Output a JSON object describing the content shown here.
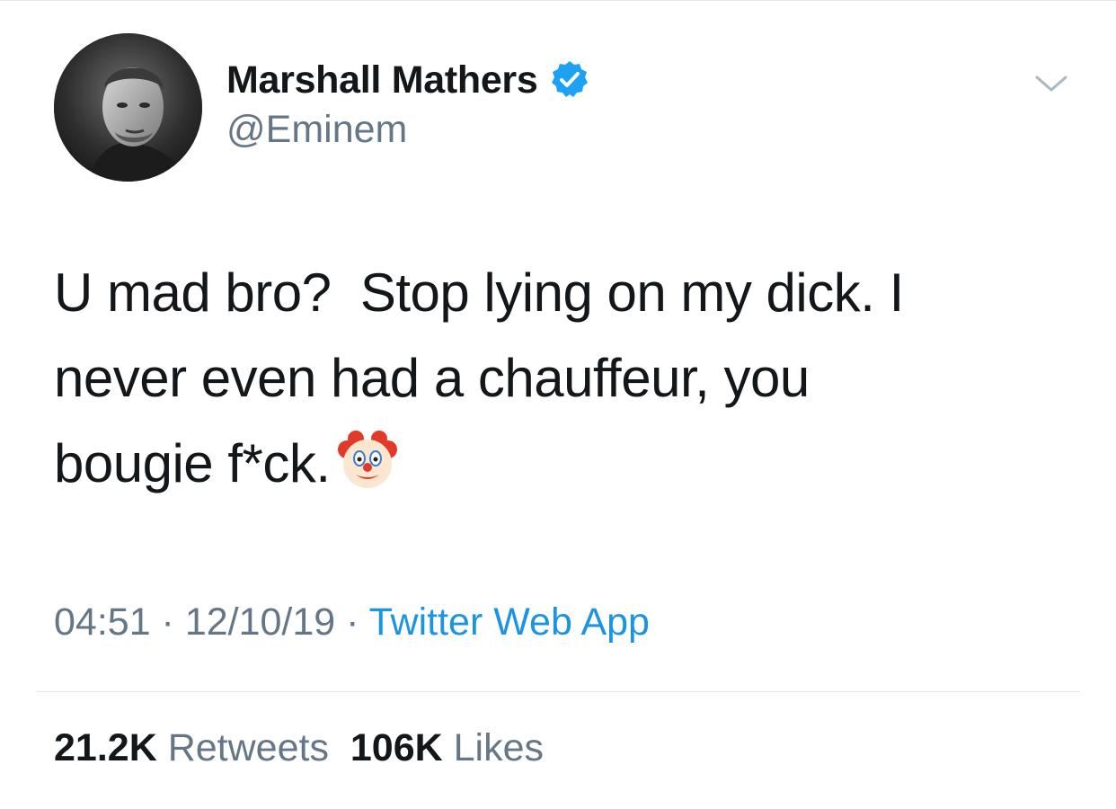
{
  "tweet": {
    "author": {
      "display_name": "Marshall Mathers",
      "handle": "@Eminem",
      "verified": true,
      "avatar_icon": "profile-photo"
    },
    "text_lines": [
      "U mad bro?  Stop lying on my dick. I",
      "never even had a chauffeur, you",
      "bougie f*ck."
    ],
    "emoji": "clown-face",
    "meta": {
      "time": "04:51",
      "separator": " · ",
      "date": "12/10/19",
      "source": "Twitter Web App"
    },
    "stats": {
      "retweets_count": "21.2K",
      "retweets_label": "Retweets",
      "likes_count": "106K",
      "likes_label": "Likes"
    }
  },
  "colors": {
    "primary_text": "#14171a",
    "secondary_text": "#657786",
    "link": "#1b95e0",
    "verified": "#1da1f2",
    "divider": "#e1e8ed"
  },
  "icons": {
    "menu": "chevron-down-icon",
    "verified": "verified-badge-icon"
  }
}
